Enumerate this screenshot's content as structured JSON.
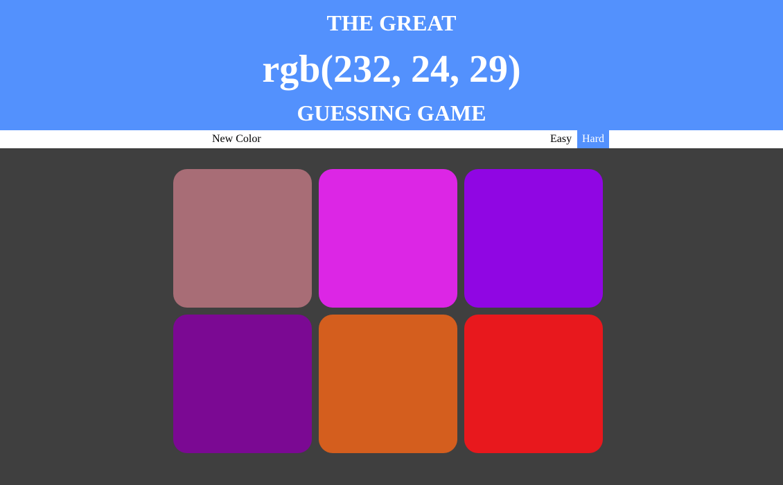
{
  "header": {
    "title_top": "THE GREAT",
    "rgb_display": "rgb(232, 24, 29)",
    "title_bottom": "GUESSING GAME",
    "background_color": "#5391fd"
  },
  "stripe": {
    "new_color_label": "New Color",
    "easy_label": "Easy",
    "hard_label": "Hard",
    "selected_mode": "Hard"
  },
  "squares": [
    {
      "color": "#a86d76"
    },
    {
      "color": "#dc26e5"
    },
    {
      "color": "#9006e3"
    },
    {
      "color": "#7b0993"
    },
    {
      "color": "#d45e1e"
    },
    {
      "color": "#e8181d"
    }
  ],
  "colors": {
    "page_background": "#3f3f3f",
    "accent": "#5391fd"
  }
}
